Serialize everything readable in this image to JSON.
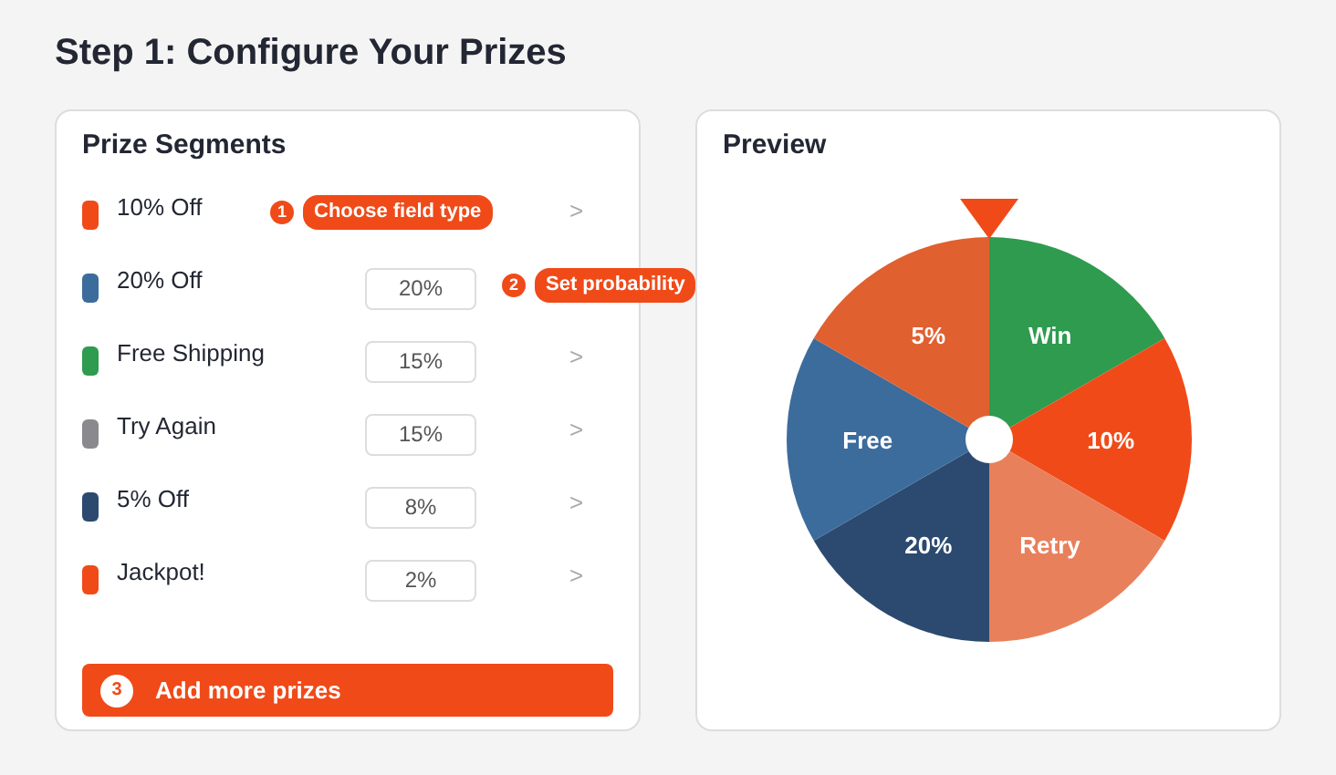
{
  "title": "Step 1: Configure Your Prizes",
  "segments_panel": {
    "title": "Prize Segments",
    "prizes": [
      {
        "name": "10% Off",
        "color": "#f04a19",
        "chevron": ">",
        "callout": {
          "number": "1",
          "text": "Choose field type",
          "kind": "cover"
        }
      },
      {
        "name": "20% Off",
        "color": "#3b6c9c",
        "probability": "20%",
        "callout": {
          "number": "2",
          "text": "Set probability",
          "kind": "after"
        }
      },
      {
        "name": "Free Shipping",
        "color": "#2e9b4f",
        "probability": "15%",
        "chevron": ">"
      },
      {
        "name": "Try Again",
        "color": "#8a8a8e",
        "probability": "15%",
        "chevron": ">"
      },
      {
        "name": "5% Off",
        "color": "#2c4a6f",
        "probability": "8%",
        "chevron": ">"
      },
      {
        "name": "Jackpot!",
        "color": "#f04a19",
        "probability": "2%",
        "chevron": ">"
      }
    ],
    "add_button": {
      "number": "3",
      "label": "Add more prizes"
    }
  },
  "preview": {
    "title": "Preview",
    "wheel": [
      {
        "label": "Win",
        "color": "#2e9b4f"
      },
      {
        "label": "10%",
        "color": "#f04a19"
      },
      {
        "label": "Retry",
        "color": "#e9805c"
      },
      {
        "label": "20%",
        "color": "#2c4a6f"
      },
      {
        "label": "Free",
        "color": "#3b6c9c"
      },
      {
        "label": "5%",
        "color": "#e06030"
      }
    ]
  }
}
